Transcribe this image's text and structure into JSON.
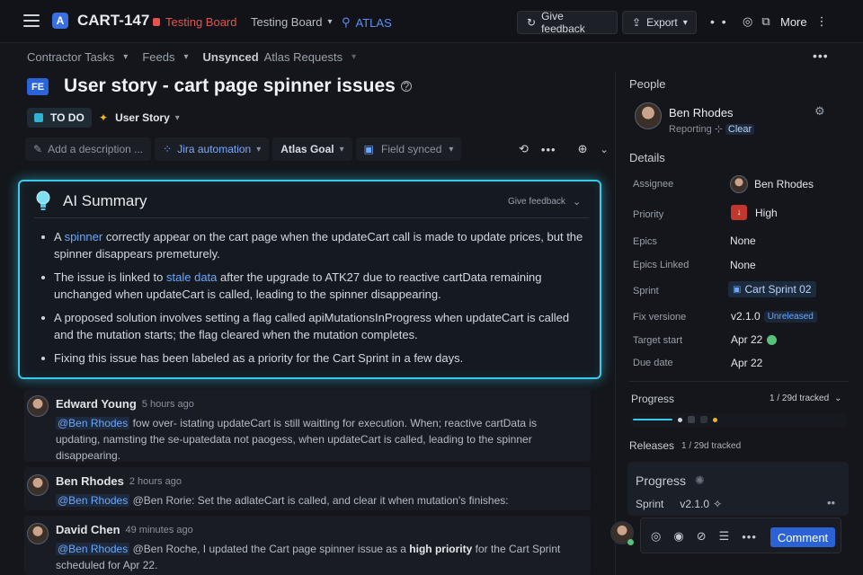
{
  "topbar": {
    "issue_key": "CART-147",
    "board_red": "Testing Board",
    "board_select": "Testing Board",
    "atlas": "ATLAS",
    "feedback": "Give feedback",
    "export": "Export",
    "more": "More"
  },
  "crumbs": {
    "a": "Contractor Tasks",
    "b": "Feeds",
    "c_bold": "Unsynced",
    "c_rest": "Atlas Requests"
  },
  "issue": {
    "badge": "FE",
    "title": "User story - cart page spinner issues",
    "status": "TO DO",
    "type": "User Story"
  },
  "toolbar": {
    "description": "Add a description ...",
    "automation": "Jira automation",
    "goal": "Atlas Goal",
    "field": "Field synced"
  },
  "ai": {
    "title": "AI Summary",
    "feedback": "Give feedback",
    "b1_pre": "A ",
    "b1_link": "spinner",
    "b1_post": " correctly appear on the cart page when the updateCart call is made to update prices, but the spinner disappears premeturely.",
    "b2_pre": "The issue is linked to ",
    "b2_link": "stale data",
    "b2_post": " after the upgrade to ATK27 due to reactive cartData remaining unchanged when updateCart is called, leading to the spinner disappearing.",
    "b3": "A proposed solution involves setting a flag called apiMutationsInProgress when updateCart is called and the mutation starts; the flag cleared when the mutation completes.",
    "b4": "Fixing this issue has been labeled as a priority for the Cart Sprint in a few days."
  },
  "comments": [
    {
      "name": "Edward Young",
      "time": "5 hours ago",
      "mention": "@Ben Rhodes",
      "text": "fow over- istating updateCart is still waitting for execution. When; reactive cartData is updating, namsting the se-upatedata not paogess, when updateCart is called, leading to the spinner disappearing."
    },
    {
      "name": "Ben Rhodes",
      "time": "2 hours ago",
      "mention": "@Ben Rhodes",
      "text": "@Ben Rorie: Set the adlateCart is called, and clear it when mutation's finishes:"
    },
    {
      "name": "David Chen",
      "time": "49 minutes ago",
      "mention": "@Ben Rhodes",
      "text_pre": "@Ben Roche, I updated the Cart page spinner issue as a ",
      "text_bold": "high priority",
      "text_post": " for the Cart Sprint scheduled for Apr 22."
    }
  ],
  "people": {
    "heading": "People",
    "name": "Ben Rhodes",
    "reporting": "Reporting",
    "clear": "Clear"
  },
  "details": {
    "heading": "Details",
    "rows": [
      {
        "label": "Assignee",
        "value": "Ben Rhodes"
      },
      {
        "label": "Priority",
        "value": "High"
      },
      {
        "label": "Epics",
        "value": "None"
      },
      {
        "label": "Epics Linked",
        "value": "None"
      },
      {
        "label": "Sprint",
        "value": "Cart Sprint 02"
      },
      {
        "label": "Fix versione",
        "value": "v2.1.0",
        "badge": "Unreleased"
      },
      {
        "label": "Target start",
        "value": "Apr 22"
      },
      {
        "label": "Due date",
        "value": "Apr 22"
      }
    ]
  },
  "progress": {
    "heading": "Progress",
    "tracked": "1 / 29d tracked",
    "fraction": 0.034
  },
  "releases": {
    "heading": "Releases",
    "tracked": "1 / 29d tracked"
  },
  "card": {
    "title": "Progress",
    "sprint": "Sprint",
    "version": "v2.1.0"
  },
  "comment_bar": {
    "button": "Comment"
  },
  "colors": {
    "accent": "#39c9ea",
    "primary": "#2b63d6",
    "danger": "#e5534b"
  }
}
